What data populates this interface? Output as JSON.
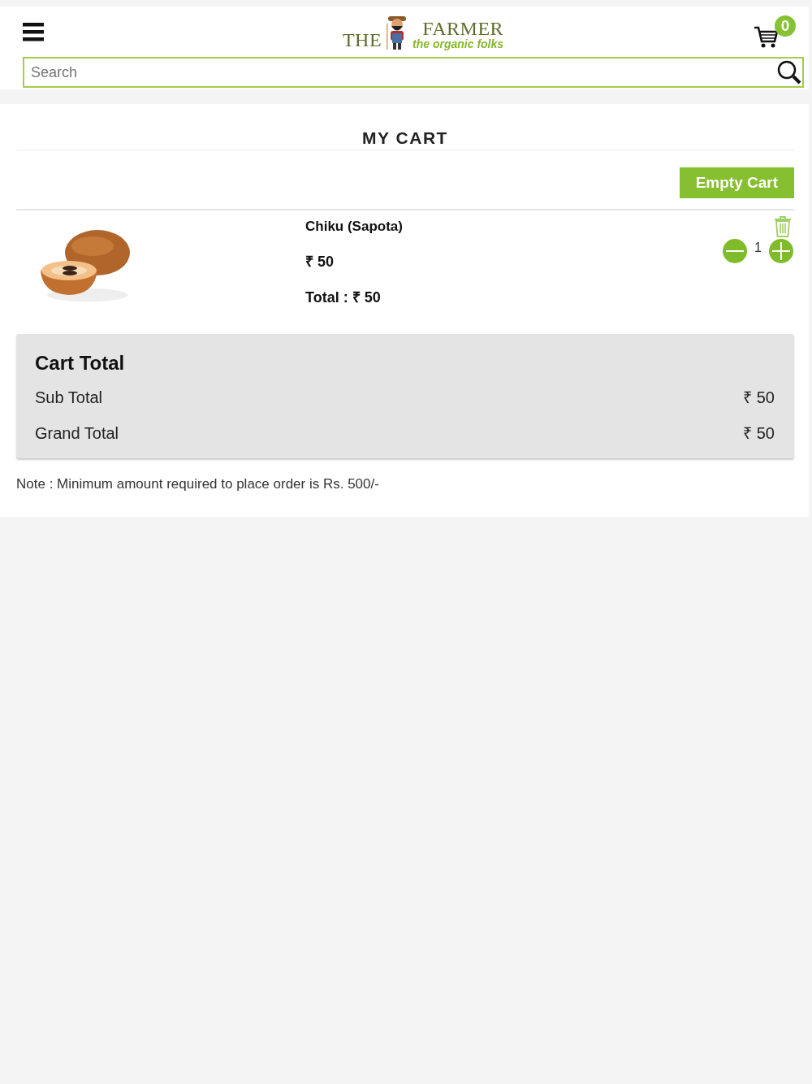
{
  "header": {
    "logo": {
      "word_1": "THE",
      "word_2": "FARMER",
      "tagline": "the organic folks"
    },
    "cart_count": "0"
  },
  "search": {
    "placeholder": "Search"
  },
  "cart": {
    "title": "MY CART",
    "empty_button": "Empty Cart",
    "items": [
      {
        "name": "Chiku (Sapota)",
        "price": "₹ 50",
        "total": "Total : ₹ 50",
        "quantity": "1"
      }
    ]
  },
  "cart_total": {
    "title": "Cart Total",
    "rows": [
      {
        "label": "Sub Total",
        "value": "₹ 50"
      },
      {
        "label": "Grand Total",
        "value": "₹ 50"
      }
    ]
  },
  "note": "Note : Minimum amount required to place order is Rs. 500/-"
}
